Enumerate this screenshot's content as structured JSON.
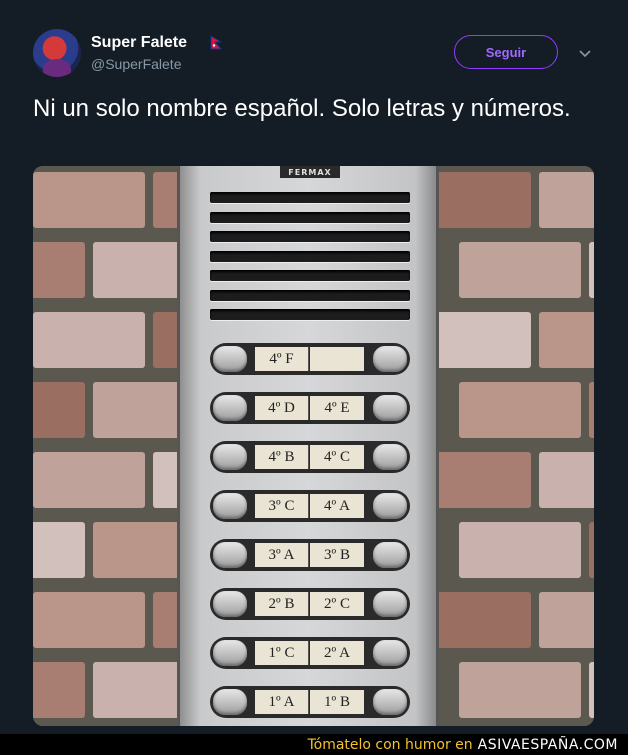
{
  "tweet": {
    "display_name": "Super Falete",
    "handle": "@SuperFalete",
    "text": "Ni un solo nombre español. Solo letras y números.",
    "follow_label": "Seguir"
  },
  "photo": {
    "brand": "FERMAX",
    "rows": [
      {
        "a": "4º F",
        "b": ""
      },
      {
        "a": "4º D",
        "b": "4º E"
      },
      {
        "a": "4º B",
        "b": "4º C"
      },
      {
        "a": "3º C",
        "b": "4º A"
      },
      {
        "a": "3º A",
        "b": "3º B"
      },
      {
        "a": "2º B",
        "b": "2º C"
      },
      {
        "a": "1º C",
        "b": "2º A"
      },
      {
        "a": "1º A",
        "b": "1º B"
      }
    ]
  },
  "watermark": {
    "prefix": "Tómatelo con humor en",
    "site": "ASIVAESPAÑA.COM"
  },
  "colors": {
    "background": "#141d26",
    "accent": "#8f3cff",
    "muted_text": "#8899a6"
  }
}
